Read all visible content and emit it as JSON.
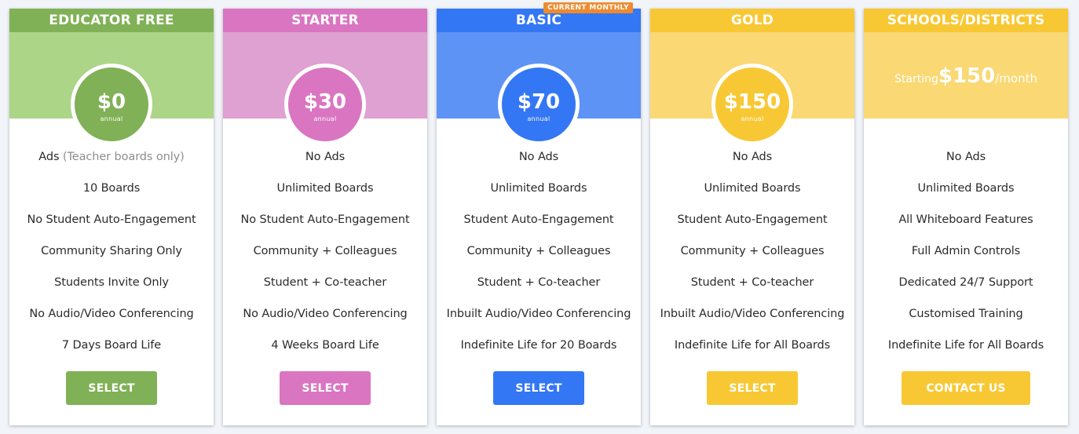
{
  "plans": [
    {
      "id": "educator-free",
      "name": "EDUCATOR FREE",
      "colors": {
        "header": "#80b156",
        "hero": "#acd587",
        "circle": "#80b156",
        "button": "#80b156"
      },
      "price": "$0",
      "period": "annual",
      "features": [
        "10 Boards",
        "No Student Auto-Engagement",
        "Community Sharing Only",
        "Students Invite Only",
        "No Audio/Video Conferencing",
        "7 Days Board Life"
      ],
      "ads_label": "Ads",
      "ads_note": "(Teacher boards only)",
      "button_label": "SELECT"
    },
    {
      "id": "starter",
      "name": "STARTER",
      "colors": {
        "header": "#da75c1",
        "hero": "#dfa0d2",
        "circle": "#da75c1",
        "button": "#da75c1"
      },
      "price": "$30",
      "period": "annual",
      "features": [
        "No Ads",
        "Unlimited Boards",
        "No Student Auto-Engagement",
        "Community + Colleagues",
        "Student + Co-teacher",
        "No Audio/Video Conferencing",
        "4 Weeks Board Life"
      ],
      "button_label": "SELECT"
    },
    {
      "id": "basic",
      "name": "BASIC",
      "badge": "CURRENT MONTHLY",
      "colors": {
        "header": "#3377f4",
        "hero": "#5e93f6",
        "circle": "#3377f4",
        "button": "#3377f4",
        "badge": "#ef8a2e"
      },
      "price": "$70",
      "period": "annual",
      "features": [
        "No Ads",
        "Unlimited Boards",
        "Student Auto-Engagement",
        "Community + Colleagues",
        "Student + Co-teacher",
        "Inbuilt Audio/Video Conferencing",
        "Indefinite Life for 20 Boards"
      ],
      "button_label": "SELECT"
    },
    {
      "id": "gold",
      "name": "GOLD",
      "colors": {
        "header": "#f8c834",
        "hero": "#fad873",
        "circle": "#f8c834",
        "button": "#f8c834"
      },
      "price": "$150",
      "period": "annual",
      "features": [
        "No Ads",
        "Unlimited Boards",
        "Student Auto-Engagement",
        "Community + Colleagues",
        "Student + Co-teacher",
        "Inbuilt Audio/Video Conferencing",
        "Indefinite Life for All Boards"
      ],
      "button_label": "SELECT"
    },
    {
      "id": "schools-districts",
      "name": "SCHOOLS/DISTRICTS",
      "colors": {
        "header": "#f8c834",
        "hero": "#fad873",
        "button": "#f8c834"
      },
      "price_prefix": "Starting",
      "price": "$150",
      "price_suffix": "/month",
      "features": [
        "No Ads",
        "Unlimited Boards",
        "All Whiteboard Features",
        "Full Admin Controls",
        "Dedicated 24/7 Support",
        "Customised Training",
        "Indefinite Life for All Boards"
      ],
      "button_label": "CONTACT US"
    }
  ]
}
